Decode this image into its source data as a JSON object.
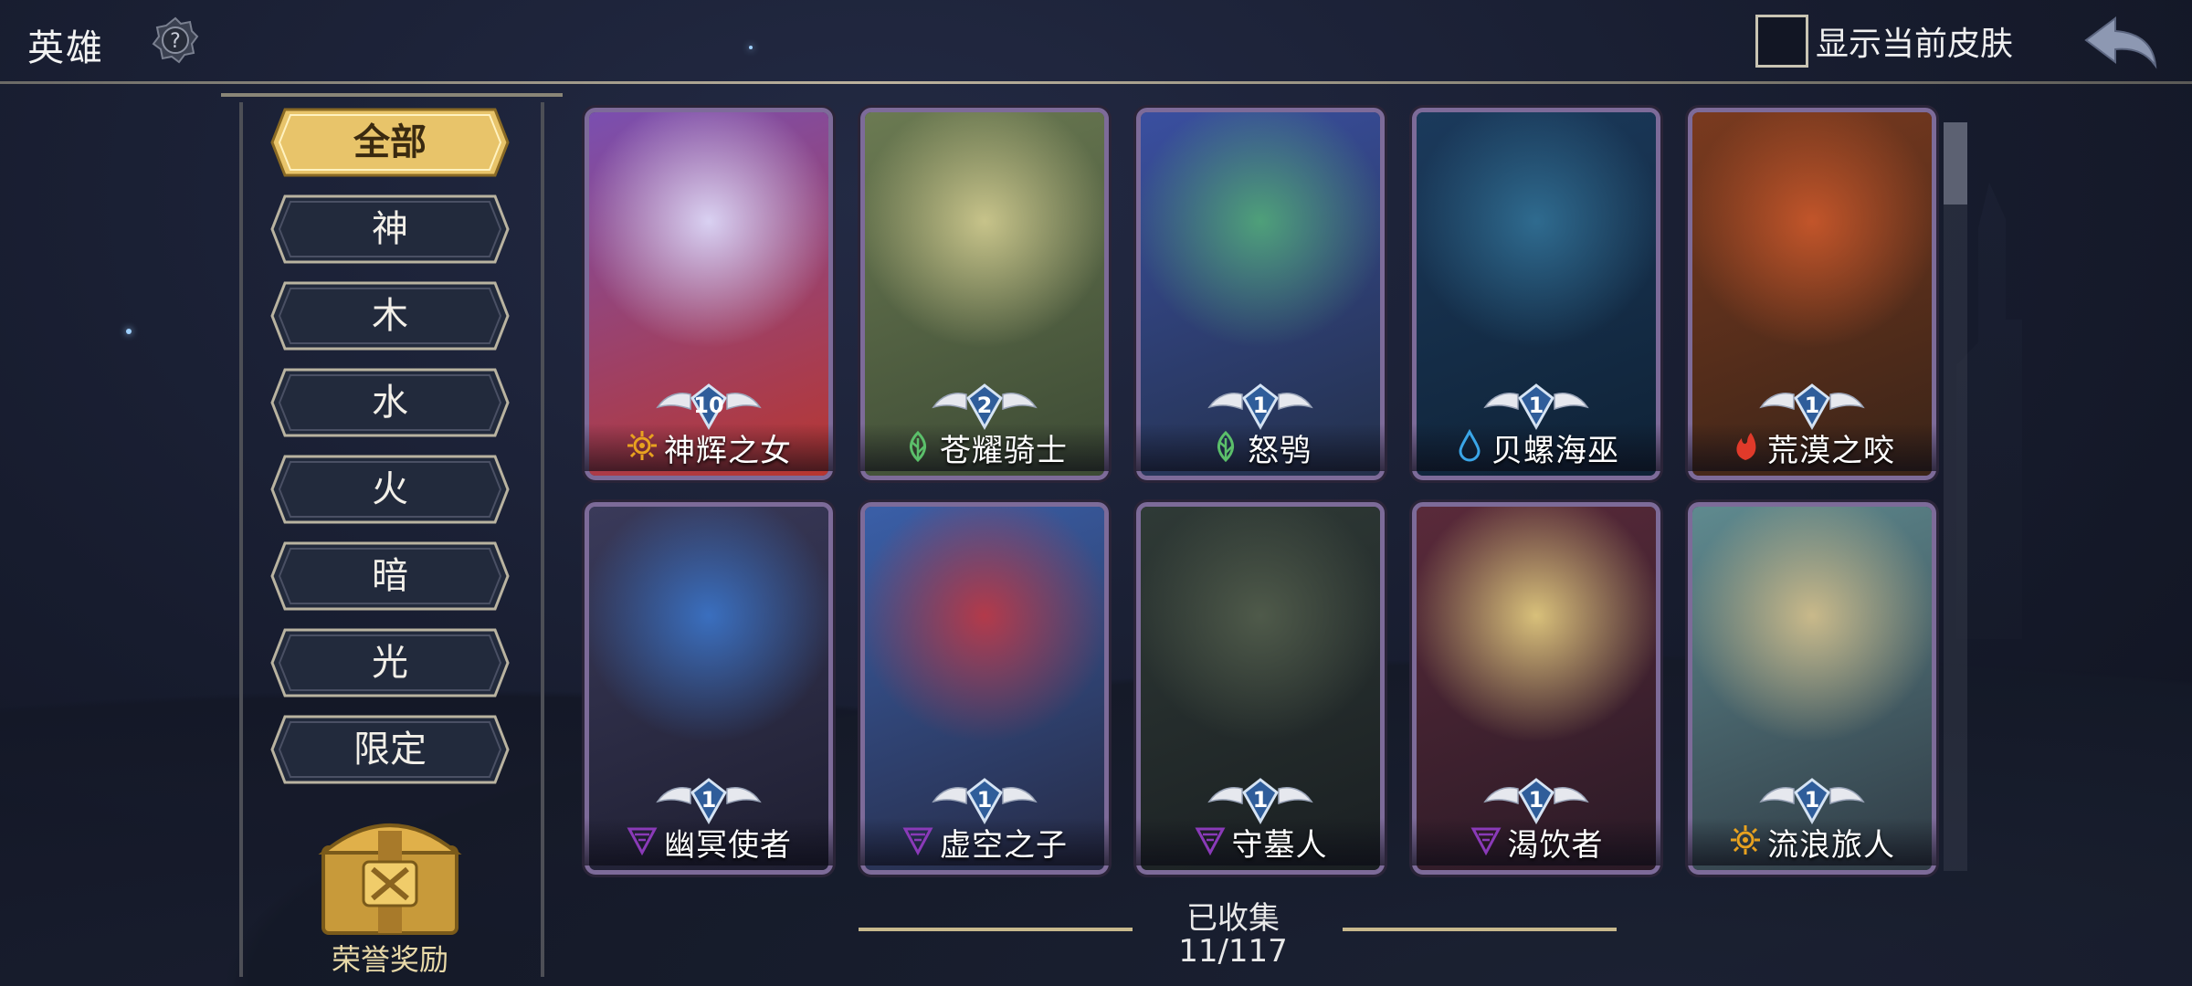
{
  "header": {
    "title": "英雄",
    "help_icon": "question-gear-icon",
    "skin_toggle_label": "显示当前皮肤",
    "back_icon": "back-arrow-icon"
  },
  "filters": [
    {
      "label": "全部",
      "active": true
    },
    {
      "label": "神",
      "active": false
    },
    {
      "label": "木",
      "active": false
    },
    {
      "label": "水",
      "active": false
    },
    {
      "label": "火",
      "active": false
    },
    {
      "label": "暗",
      "active": false
    },
    {
      "label": "光",
      "active": false
    },
    {
      "label": "限定",
      "active": false
    }
  ],
  "reward": {
    "label": "荣誉奖励",
    "icon": "treasure-chest-icon"
  },
  "heroes": [
    {
      "name": "神辉之女",
      "level": "10",
      "element": "light",
      "art": [
        "#d9d1f2",
        "#7a4fb0",
        "#b8362f"
      ]
    },
    {
      "name": "苍耀骑士",
      "level": "2",
      "element": "wood",
      "art": [
        "#c7c38a",
        "#6b7a52",
        "#3c4a34"
      ]
    },
    {
      "name": "怒鸮",
      "level": "1",
      "element": "wood",
      "art": [
        "#4fa07a",
        "#3a4fa0",
        "#23304a"
      ]
    },
    {
      "name": "贝螺海巫",
      "level": "1",
      "element": "water",
      "art": [
        "#2f6b8f",
        "#1b3a5c",
        "#0f2236"
      ]
    },
    {
      "name": "荒漠之咬",
      "level": "1",
      "element": "fire",
      "art": [
        "#c2552a",
        "#7a3a1f",
        "#3a2418"
      ]
    },
    {
      "name": "幽冥使者",
      "level": "1",
      "element": "dark",
      "art": [
        "#3a6fbf",
        "#3a3a5a",
        "#1e1e30"
      ]
    },
    {
      "name": "虚空之子",
      "level": "1",
      "element": "dark",
      "art": [
        "#b33a4a",
        "#3a5fa8",
        "#262a44"
      ]
    },
    {
      "name": "守墓人",
      "level": "1",
      "element": "dark",
      "art": [
        "#4f5a4a",
        "#2f3a36",
        "#1a1f22"
      ]
    },
    {
      "name": "渴饮者",
      "level": "1",
      "element": "dark",
      "art": [
        "#d8c07a",
        "#5a2a3a",
        "#2a1a26"
      ]
    },
    {
      "name": "流浪旅人",
      "level": "1",
      "element": "light",
      "art": [
        "#c9b98a",
        "#5f8a8f",
        "#2f3a44"
      ]
    }
  ],
  "collection": {
    "label": "已收集",
    "count": "11/117",
    "collected": 11,
    "total": 117
  },
  "colors": {
    "light": "#e8a21f",
    "wood": "#5bbf6a",
    "water": "#3aa6e8",
    "fire": "#e03a2a",
    "dark": "#8a3ab8",
    "gold": "#e8c46a"
  }
}
